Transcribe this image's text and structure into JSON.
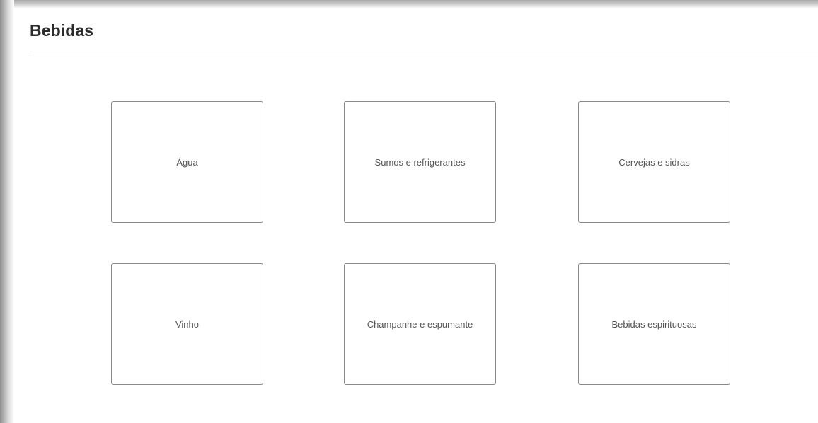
{
  "page": {
    "title": "Bebidas"
  },
  "categories": [
    {
      "label": "Água"
    },
    {
      "label": "Sumos e refrigerantes"
    },
    {
      "label": "Cervejas e sidras"
    },
    {
      "label": "Vinho"
    },
    {
      "label": "Champanhe e espumante"
    },
    {
      "label": "Bebidas espirituosas"
    }
  ],
  "colors": {
    "title": "#2b2b2b",
    "card_border": "#8a8a8a",
    "card_label": "#555555",
    "divider": "#e5e5e5",
    "background": "#ffffff"
  }
}
